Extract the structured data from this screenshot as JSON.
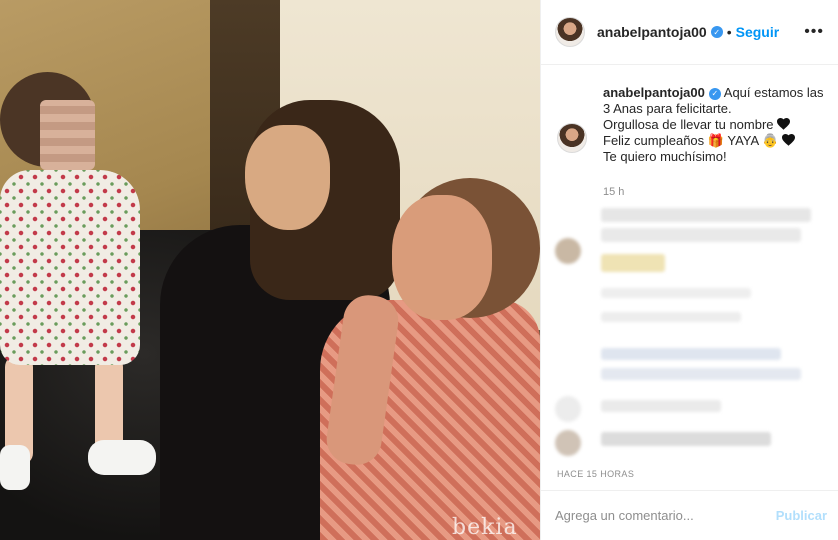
{
  "header": {
    "username": "anabelpantoja00",
    "separator": "•",
    "follow_label": "Seguir",
    "more_icon": "more-options-icon"
  },
  "caption": {
    "username": "anabelpantoja00",
    "line1": "Aquí estamos las",
    "line2": "3 Anas para felicitarte.",
    "line3": "Orgullosa de llevar tu nombre",
    "line4_a": "Feliz cumpleaños",
    "line4_b": "YAYA",
    "line5": "Te quiero muchísimo!",
    "time_ago": "15 h",
    "emoji_gift": "🎁",
    "emoji_grandma": "👵"
  },
  "post_meta": {
    "date_label": "HACE 15 HORAS"
  },
  "comment_bar": {
    "placeholder": "Agrega un comentario...",
    "post_label": "Publicar"
  },
  "photo": {
    "watermark": "bekia"
  },
  "colors": {
    "accent": "#0095f6",
    "post_disabled": "#b2dffc",
    "verified": "#3897f0"
  }
}
